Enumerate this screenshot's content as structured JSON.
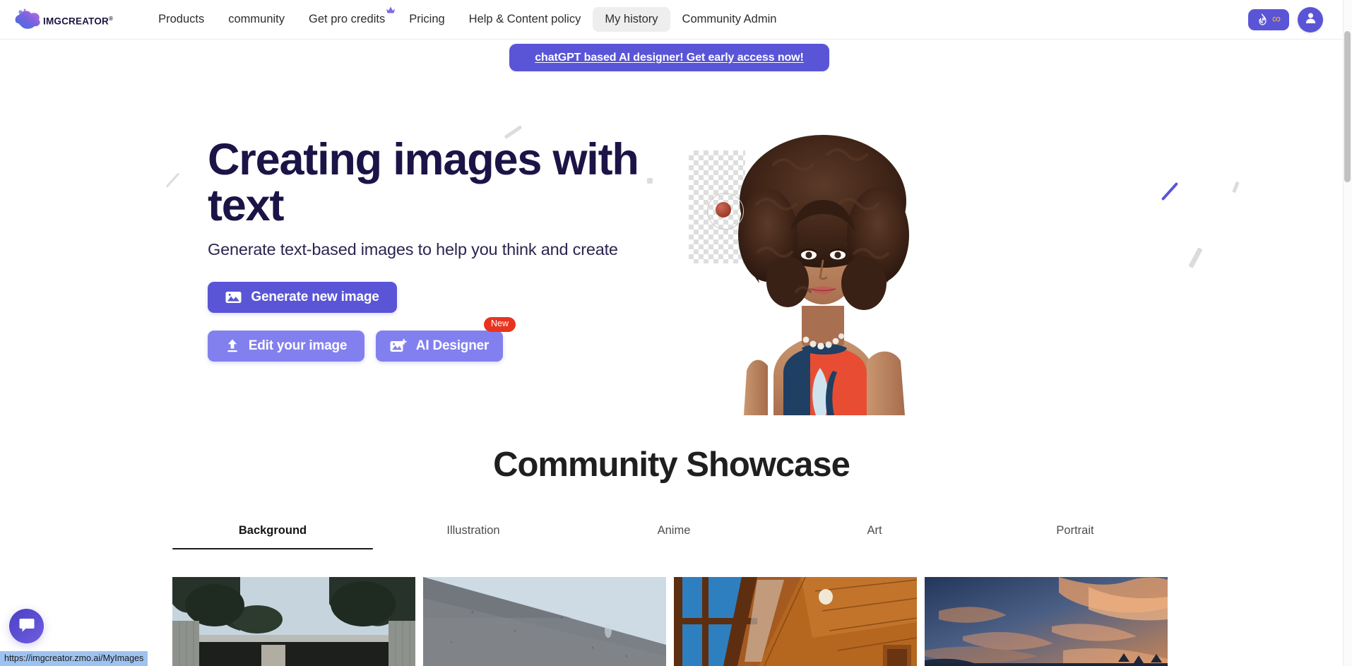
{
  "navbar": {
    "brand": {
      "name": "IMGCREATOR",
      "superscript": "®",
      "logo_icon": "imgcreator-blob-logo"
    },
    "links": [
      {
        "label": "Products",
        "active": false,
        "badge_icon": null
      },
      {
        "label": "community",
        "active": false,
        "badge_icon": null
      },
      {
        "label": "Get pro credits",
        "active": false,
        "badge_icon": "crown-icon"
      },
      {
        "label": "Pricing",
        "active": false,
        "badge_icon": null
      },
      {
        "label": "Help & Content policy",
        "active": false,
        "badge_icon": null
      },
      {
        "label": "My history",
        "active": true,
        "badge_icon": null
      },
      {
        "label": "Community Admin",
        "active": false,
        "badge_icon": null
      }
    ],
    "credits": {
      "flame_icon": "flame-icon",
      "value": "∞",
      "accent": "#5a55d6",
      "value_color": "#f5b02e"
    },
    "avatar": {
      "icon": "user-icon",
      "background": "#5a55d6"
    }
  },
  "promo_banner": {
    "text": "chatGPT based AI designer! Get early access now!",
    "background": "#5a55d6",
    "text_color": "#ffffff"
  },
  "hero": {
    "title": "Creating images with text",
    "subtitle": "Generate text-based images to help you think and create",
    "buttons": [
      {
        "label": "Generate new image",
        "icon": "image-icon",
        "style": "primary",
        "badge": null
      },
      {
        "label": "Edit your image",
        "icon": "upload-icon",
        "style": "secondary",
        "badge": null
      },
      {
        "label": "AI Designer",
        "icon": "image-plus-icon",
        "style": "tertiary",
        "badge": "New"
      }
    ],
    "image_alt": "portrait of woman with curly afro hair wearing red and navy tank top with pearl necklace, transparent checkerboard background"
  },
  "showcase": {
    "title": "Community Showcase",
    "tabs": [
      {
        "label": "Background",
        "active": true
      },
      {
        "label": "Illustration",
        "active": false
      },
      {
        "label": "Anime",
        "active": false
      },
      {
        "label": "Art",
        "active": false
      },
      {
        "label": "Portrait",
        "active": false
      }
    ],
    "gallery": [
      {
        "alt": "modern concrete house behind wall framed by dark trees under pale blue sky"
      },
      {
        "alt": "angled grey concrete wall against pale blue sky"
      },
      {
        "alt": "wooden vaulted ceiling interior with tall windows showing blue sky"
      },
      {
        "alt": "sunset sky with orange and pink streaked clouds"
      }
    ]
  },
  "chat_widget": {
    "icon": "chat-bubble-icon",
    "background": "#5a55d6"
  },
  "status_bar": {
    "url": "https://imgcreator.zmo.ai/MyImages"
  },
  "colors": {
    "brand_purple": "#5a55d6",
    "light_purple": "#8280ef",
    "badge_red": "#e8341f",
    "headline_navy": "#1b1447",
    "credit_gold": "#f5b02e"
  }
}
